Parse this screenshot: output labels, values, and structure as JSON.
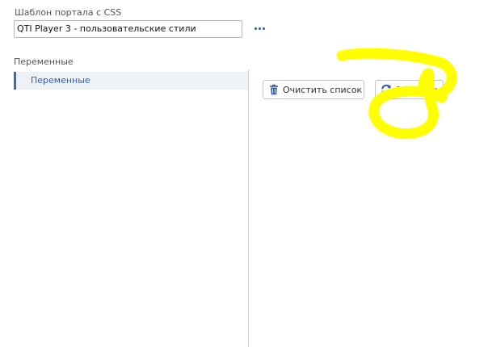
{
  "template": {
    "label": "Шаблон портала с CSS",
    "value": "QTI Player 3 - пользовательские стили"
  },
  "variables": {
    "heading": "Переменные",
    "items": [
      {
        "label": "Переменные",
        "selected": true
      }
    ]
  },
  "toolbar": {
    "clear_label": "Очистить список",
    "clear_icon": "trash-icon",
    "refresh_label": "Обновить",
    "refresh_icon": "refresh-icon"
  },
  "colors": {
    "accent": "#2f5ea8",
    "highlight_scribble": "#ffff00"
  }
}
